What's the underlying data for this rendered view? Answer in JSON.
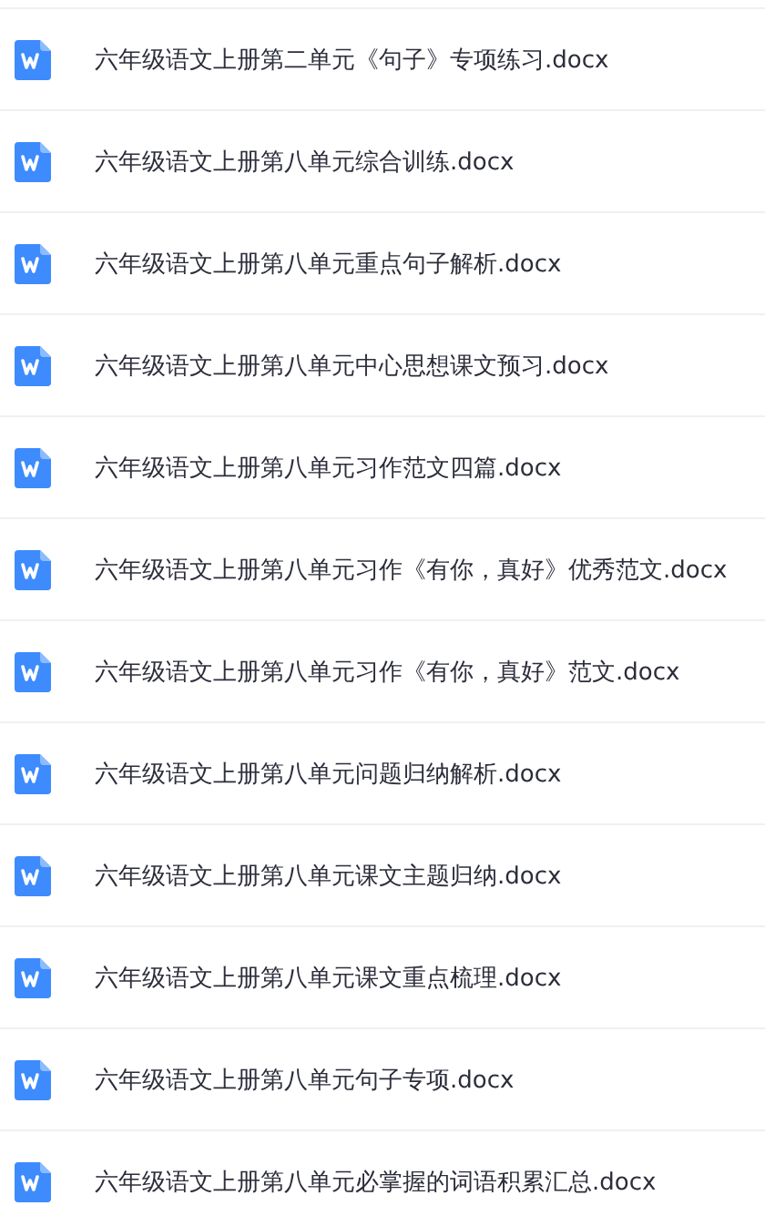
{
  "files": [
    {
      "name": "六年级语文上册第二单元《句子》专项练习.docx",
      "kind": "word"
    },
    {
      "name": "六年级语文上册第八单元综合训练.docx",
      "kind": "word"
    },
    {
      "name": "六年级语文上册第八单元重点句子解析.docx",
      "kind": "word"
    },
    {
      "name": "六年级语文上册第八单元中心思想课文预习.docx",
      "kind": "word"
    },
    {
      "name": "六年级语文上册第八单元习作范文四篇.docx",
      "kind": "word"
    },
    {
      "name": "六年级语文上册第八单元习作《有你，真好》优秀范文.docx",
      "kind": "word"
    },
    {
      "name": "六年级语文上册第八单元习作《有你，真好》范文.docx",
      "kind": "word"
    },
    {
      "name": "六年级语文上册第八单元问题归纳解析.docx",
      "kind": "word"
    },
    {
      "name": "六年级语文上册第八单元课文主题归纳.docx",
      "kind": "word"
    },
    {
      "name": "六年级语文上册第八单元课文重点梳理.docx",
      "kind": "word"
    },
    {
      "name": "六年级语文上册第八单元句子专项.docx",
      "kind": "word"
    },
    {
      "name": "六年级语文上册第八单元必掌握的词语积累汇总.docx",
      "kind": "word"
    }
  ]
}
